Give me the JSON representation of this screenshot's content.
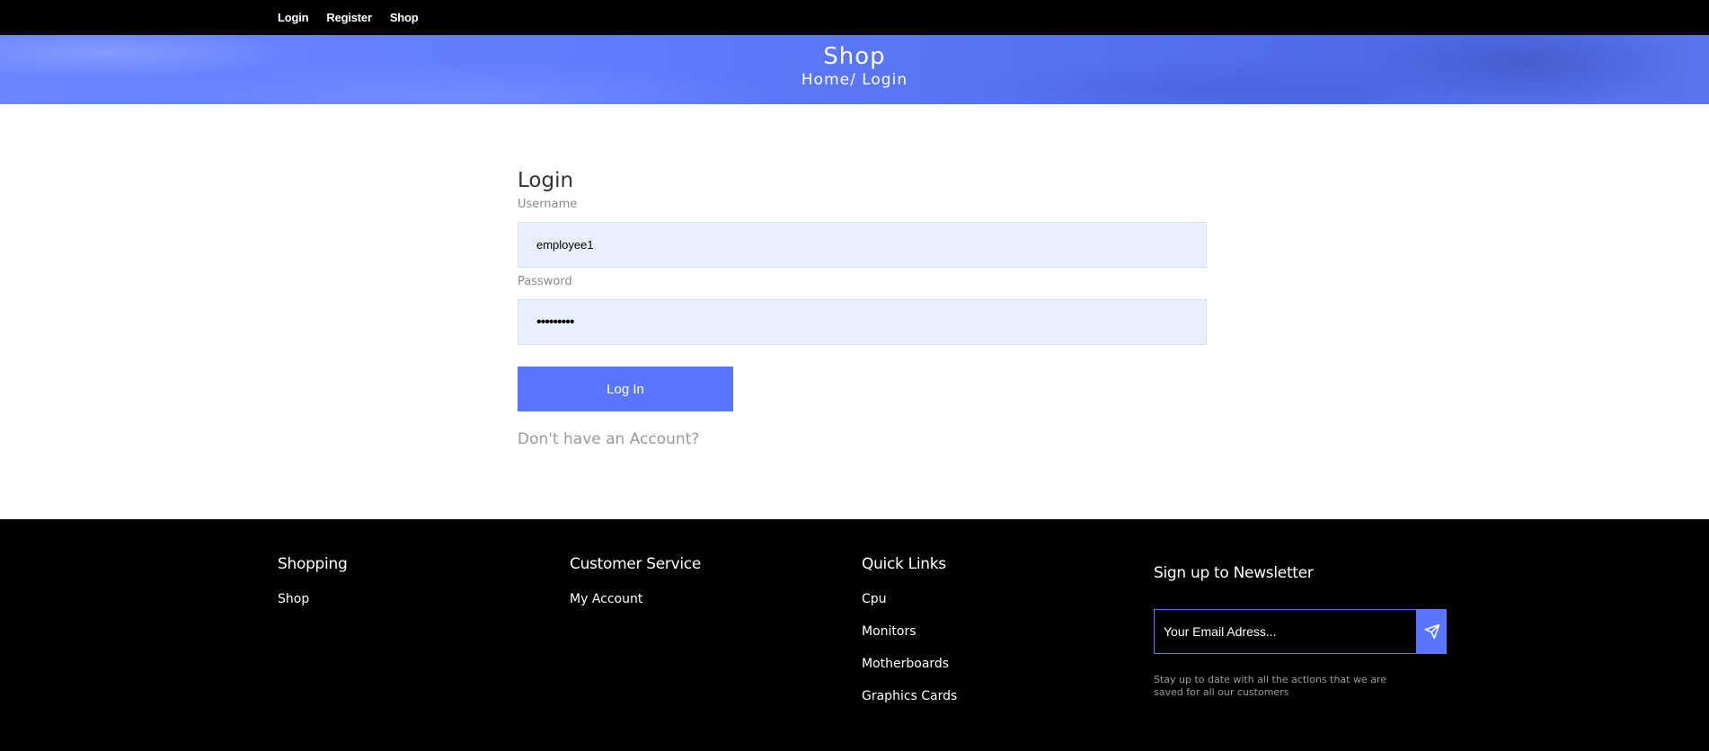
{
  "nav": {
    "items": [
      "Login",
      "Register",
      "Shop"
    ]
  },
  "hero": {
    "title": "Shop",
    "breadcrumb": "Home/ Login"
  },
  "login": {
    "heading": "Login",
    "username_label": "Username",
    "username_value": "employee1",
    "password_label": "Password",
    "password_value": "•••••••••",
    "submit_label": "Log In",
    "signup_link": "Don't have an Account?"
  },
  "footer": {
    "shopping": {
      "title": "Shopping",
      "items": [
        "Shop"
      ]
    },
    "customer_service": {
      "title": "Customer Service",
      "items": [
        "My Account"
      ]
    },
    "quick_links": {
      "title": "Quick Links",
      "items": [
        "Cpu",
        "Monitors",
        "Motherboards",
        "Graphics Cards"
      ]
    },
    "newsletter": {
      "title": "Sign up to Newsletter",
      "placeholder": "Your Email Adress...",
      "note": "Stay up to date with all the actions that we are saved for all our customers"
    }
  },
  "colors": {
    "accent": "#5876ff",
    "field_bg": "#e8f0fe",
    "nav_bg": "#000000"
  }
}
